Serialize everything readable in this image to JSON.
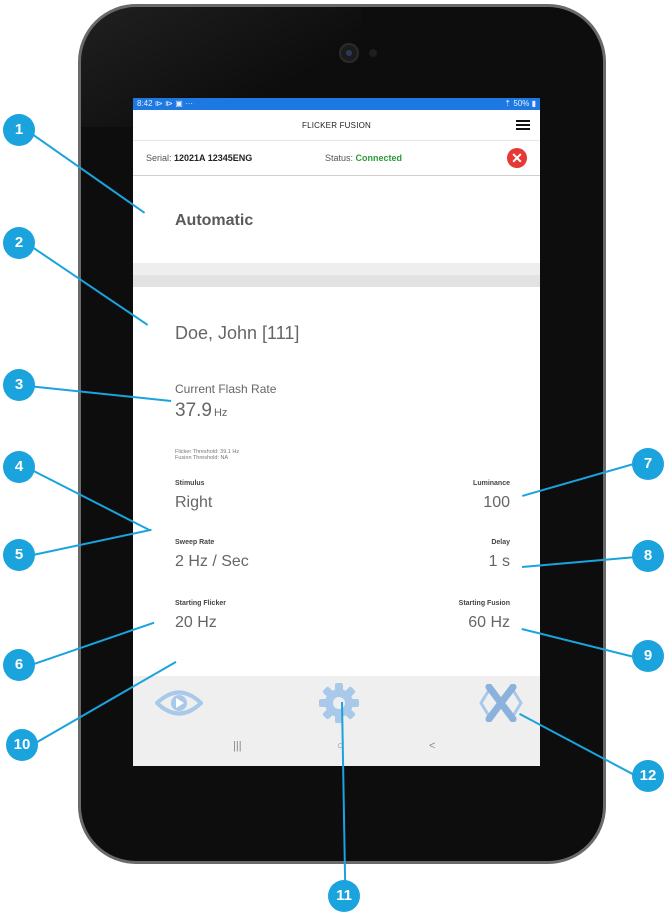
{
  "statusbar": {
    "time": "8:42",
    "left_icons": "⧐ ⧐ ▣ ···",
    "battery": "50%"
  },
  "appbar": {
    "title": "FLICKER FUSION"
  },
  "device": {
    "serial_label": "Serial:",
    "serial_value": "12021A 12345ENG",
    "status_label": "Status:",
    "status_value": "Connected",
    "status_color": "#2e9a3a"
  },
  "mode": "Automatic",
  "patient": "Doe, John [111]",
  "flash": {
    "label": "Current Flash Rate",
    "value": "37.9",
    "unit": "Hz"
  },
  "thresholds": {
    "flicker": "Flicker Threshold: 39.1 Hz",
    "fusion": "Fusion Threshold: NA"
  },
  "settings": {
    "stimulus": {
      "label": "Stimulus",
      "value": "Right"
    },
    "luminance": {
      "label": "Luminance",
      "value": "100"
    },
    "sweep_rate": {
      "label": "Sweep Rate",
      "value": "2 Hz / Sec"
    },
    "delay": {
      "label": "Delay",
      "value": "1 s"
    },
    "starting_flicker": {
      "label": "Starting Flicker",
      "value": "20 Hz"
    },
    "starting_fusion": {
      "label": "Starting Fusion",
      "value": "60 Hz"
    }
  },
  "bottom_nav": {
    "icons": [
      "eye-play-icon",
      "gear-icon",
      "cross-arrows-icon"
    ],
    "icon_color": "#a9c9ea"
  },
  "system_nav": {
    "recent": "|||",
    "home": "○",
    "back": "<"
  },
  "callouts": [
    "1",
    "2",
    "3",
    "4",
    "5",
    "6",
    "7",
    "8",
    "9",
    "10",
    "11",
    "12"
  ],
  "colors": {
    "accent": "#1aa3dd",
    "statusbar": "#1e78e2",
    "close": "#e53935"
  }
}
